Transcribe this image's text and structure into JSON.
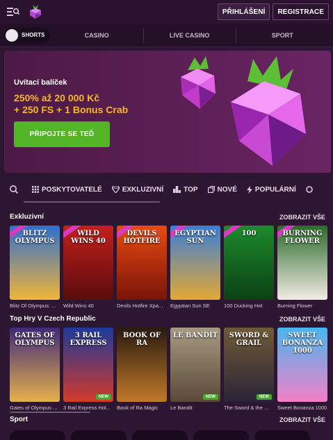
{
  "header": {
    "login_label": "PŘIHLÁŠENÍ",
    "register_label": "REGISTRACE"
  },
  "nav": {
    "shorts_label": "SHORTS",
    "tabs": [
      "CASINO",
      "LIVE CASINO",
      "SPORT"
    ]
  },
  "hero": {
    "subtitle": "Uvítací balíček",
    "title_line1": "250% až 20 000 Kč",
    "title_line2": "+ 250 FS + 1 Bonus Crab",
    "cta_label": "PŘIPOJTE SE TEĎ"
  },
  "categories": [
    {
      "label": "POSKYTOVATELÉ",
      "icon": "grid-icon"
    },
    {
      "label": "EXKLUZIVNÍ",
      "icon": "diamond-icon"
    },
    {
      "label": "TOP",
      "icon": "podium-icon"
    },
    {
      "label": "NOVÉ",
      "icon": "new-icon"
    },
    {
      "label": "POPULÁRNÍ",
      "icon": "lightning-icon"
    }
  ],
  "sections": {
    "exclusive": {
      "title": "Exkluzivní",
      "more_label": "ZOBRAZIT VŠE",
      "games": [
        {
          "name": "Blitz Of Olympus: ...",
          "art": "BLITZ OLYMPUS",
          "bg1": "#2f6fcf",
          "bg2": "#f0b43a",
          "ribbon": true,
          "new": false
        },
        {
          "name": "Wild Wins 40",
          "art": "WILD WINS 40",
          "bg1": "#c2201d",
          "bg2": "#5a0b0b",
          "ribbon": true,
          "new": false
        },
        {
          "name": "Devils Hotfire Xpa...",
          "art": "DEVILS HOTFIRE",
          "bg1": "#e84a12",
          "bg2": "#7a1408",
          "ribbon": true,
          "new": false
        },
        {
          "name": "Egyptian Sun SE",
          "art": "EGYPTIAN SUN",
          "bg1": "#3a7ed8",
          "bg2": "#e3a834",
          "ribbon": true,
          "new": false
        },
        {
          "name": "100 Ducking Hot",
          "art": "100",
          "bg1": "#1d8a2c",
          "bg2": "#0b4113",
          "ribbon": true,
          "new": false
        },
        {
          "name": "Burning Flower",
          "art": "BURNING FLOWER",
          "bg1": "#2b6a2a",
          "bg2": "#f2ece4",
          "ribbon": true,
          "new": false
        }
      ]
    },
    "top": {
      "title": "Top Hry V Czech Republic",
      "more_label": "ZOBRAZIT VŠE",
      "games": [
        {
          "name": "Gates of Olympus ...",
          "art": "GATES OF OLYMPUS",
          "bg1": "#3e2a7a",
          "bg2": "#e7b04b",
          "ribbon": false,
          "new": false
        },
        {
          "name": "3 Rail Express Hol...",
          "art": "3 RAIL EXPRESS",
          "bg1": "#1c3a9a",
          "bg2": "#d33a2a",
          "ribbon": false,
          "new": true
        },
        {
          "name": "Book of Ra Magic",
          "art": "BOOK OF RA",
          "bg1": "#2a1a10",
          "bg2": "#c0792a",
          "ribbon": false,
          "new": false
        },
        {
          "name": "Le Bandit",
          "art": "LE BANDIT",
          "bg1": "#a79a82",
          "bg2": "#5a4a38",
          "ribbon": false,
          "new": true
        },
        {
          "name": "The Sword & the ...",
          "art": "SWORD & GRAIL",
          "bg1": "#6f5a36",
          "bg2": "#2a2438",
          "ribbon": false,
          "new": true
        },
        {
          "name": "Sweet Bonanza 1000",
          "art": "SWEET BONANZA 1000",
          "bg1": "#48b6f0",
          "bg2": "#f37fc7",
          "ribbon": false,
          "new": false
        }
      ]
    },
    "sport": {
      "title": "Sport",
      "more_label": "ZOBRAZIT VŠE"
    }
  },
  "colors": {
    "accent_green": "#54b427",
    "accent_gold": "#f7b823",
    "background": "#2d1631"
  }
}
